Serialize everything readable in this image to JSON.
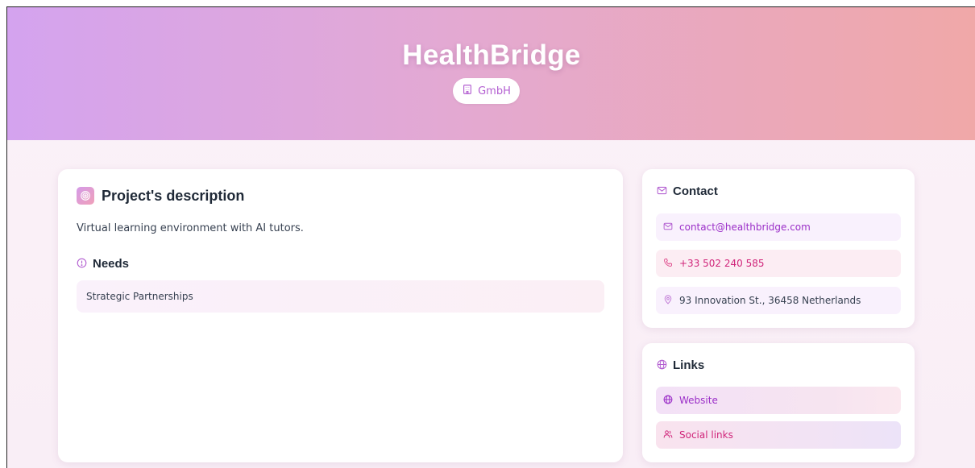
{
  "header": {
    "company_name": "HealthBridge",
    "legal_form": "GmbH"
  },
  "project": {
    "title": "Project's description",
    "description": "Virtual learning environment with AI tutors.",
    "needs_title": "Needs",
    "needs": [
      "Strategic Partnerships"
    ]
  },
  "contact": {
    "title": "Contact",
    "email": "contact@healthbridge.com",
    "phone": "+33 502 240 585",
    "address": "93 Innovation St., 36458 Netherlands"
  },
  "links": {
    "title": "Links",
    "website_label": "Website",
    "social_label": "Social links"
  },
  "colors": {
    "accent_purple": "#9b2fc8",
    "accent_pink": "#d0257a",
    "hero_gradient_start": "#d4a3ef",
    "hero_gradient_end": "#f0a8a8"
  },
  "icons": {
    "badge": "building-icon",
    "project": "target-icon",
    "needs": "alert-circle-icon",
    "contact": "mail-icon",
    "email": "mail-icon",
    "phone": "phone-icon",
    "address": "map-pin-icon",
    "links": "globe-icon",
    "website": "globe-icon",
    "social": "users-icon"
  }
}
